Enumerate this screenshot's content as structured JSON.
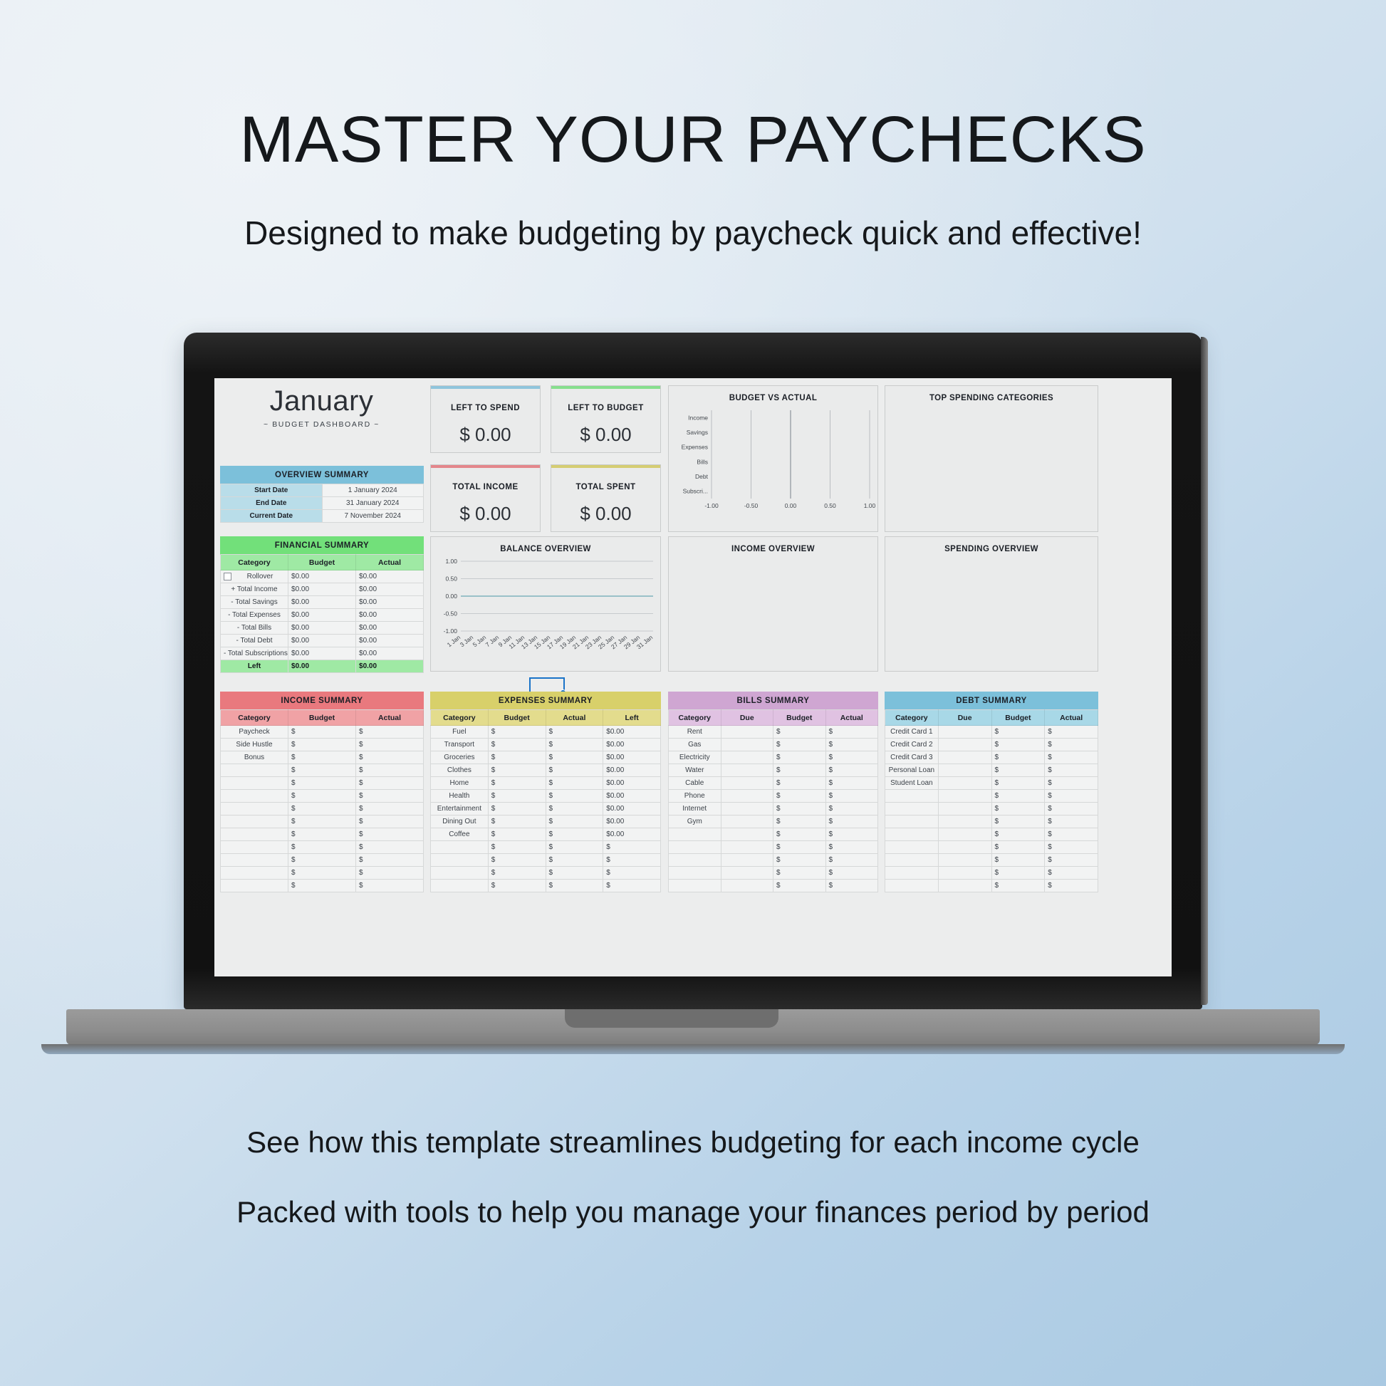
{
  "promo": {
    "title": "MASTER YOUR PAYCHECKS",
    "subtitle": "Designed to make budgeting by paycheck quick and effective!",
    "footer_line1": "See how this template streamlines budgeting for each income cycle",
    "footer_line2": "Packed with tools to help you manage your finances period by period"
  },
  "sheet": {
    "month": "January",
    "month_subtitle": "~ BUDGET DASHBOARD ~"
  },
  "kpis": [
    {
      "label": "LEFT TO SPEND",
      "value": "$ 0.00",
      "accent": "#8fc5dc"
    },
    {
      "label": "LEFT TO BUDGET",
      "value": "$ 0.00",
      "accent": "#86df8d"
    },
    {
      "label": "TOTAL INCOME",
      "value": "$ 0.00",
      "accent": "#e4868b"
    },
    {
      "label": "TOTAL SPENT",
      "value": "$ 0.00",
      "accent": "#d5cd72"
    }
  ],
  "overview_summary": {
    "title": "OVERVIEW SUMMARY",
    "rows": [
      {
        "key": "Start Date",
        "value": "1 January 2024"
      },
      {
        "key": "End Date",
        "value": "31 January 2024"
      },
      {
        "key": "Current Date",
        "value": "7 November 2024"
      }
    ]
  },
  "financial_summary": {
    "title": "FINANCIAL SUMMARY",
    "columns": [
      "Category",
      "Budget",
      "Actual"
    ],
    "rows": [
      {
        "category": "Rollover",
        "checkbox": true,
        "budget": "0.00",
        "actual": "0.00"
      },
      {
        "category": "+ Total Income",
        "checkbox": false,
        "budget": "0.00",
        "actual": "0.00"
      },
      {
        "category": "- Total Savings",
        "checkbox": false,
        "budget": "0.00",
        "actual": "0.00"
      },
      {
        "category": "- Total Expenses",
        "checkbox": false,
        "budget": "0.00",
        "actual": "0.00"
      },
      {
        "category": "- Total Bills",
        "checkbox": false,
        "budget": "0.00",
        "actual": "0.00"
      },
      {
        "category": "- Total Debt",
        "checkbox": false,
        "budget": "0.00",
        "actual": "0.00"
      },
      {
        "category": "- Total Subscriptions",
        "checkbox": false,
        "budget": "0.00",
        "actual": "0.00"
      }
    ],
    "total_row": {
      "label": "Left",
      "budget": "0.00",
      "actual": "0.00"
    }
  },
  "income_summary": {
    "title": "INCOME SUMMARY",
    "columns": [
      "Category",
      "Budget",
      "Actual"
    ],
    "categories": [
      "Paycheck",
      "Side Hustle",
      "Bonus",
      "",
      "",
      "",
      "",
      "",
      "",
      "",
      "",
      "",
      ""
    ],
    "currency": "$"
  },
  "expenses_summary": {
    "title": "EXPENSES SUMMARY",
    "columns": [
      "Category",
      "Budget",
      "Actual",
      "Left"
    ],
    "rows": [
      {
        "category": "Fuel",
        "left": "0.00"
      },
      {
        "category": "Transport",
        "left": "0.00"
      },
      {
        "category": "Groceries",
        "left": "0.00"
      },
      {
        "category": "Clothes",
        "left": "0.00"
      },
      {
        "category": "Home",
        "left": "0.00"
      },
      {
        "category": "Health",
        "left": "0.00"
      },
      {
        "category": "Entertainment",
        "left": "0.00"
      },
      {
        "category": "Dining Out",
        "left": "0.00"
      },
      {
        "category": "Coffee",
        "left": "0.00"
      },
      {
        "category": "",
        "left": ""
      },
      {
        "category": "",
        "left": ""
      },
      {
        "category": "",
        "left": ""
      },
      {
        "category": "",
        "left": ""
      }
    ],
    "currency": "$"
  },
  "bills_summary": {
    "title": "BILLS SUMMARY",
    "columns": [
      "Category",
      "Due",
      "Budget",
      "Actual"
    ],
    "categories": [
      "Rent",
      "Gas",
      "Electricity",
      "Water",
      "Cable",
      "Phone",
      "Internet",
      "Gym",
      "",
      "",
      "",
      "",
      ""
    ],
    "currency": "$"
  },
  "debt_summary": {
    "title": "DEBT SUMMARY",
    "columns": [
      "Category",
      "Due",
      "Budget",
      "Actual"
    ],
    "categories": [
      "Credit Card 1",
      "Credit Card 2",
      "Credit Card 3",
      "Personal Loan",
      "Student Loan",
      "",
      "",
      "",
      "",
      "",
      "",
      "",
      ""
    ],
    "currency": "$"
  },
  "panels": {
    "top_spending": "TOP SPENDING CATEGORIES",
    "income_overview": "INCOME OVERVIEW",
    "spending_overview": "SPENDING OVERVIEW"
  },
  "chart_data": [
    {
      "type": "bar",
      "title": "BUDGET VS ACTUAL",
      "orientation": "horizontal",
      "categories": [
        "Income",
        "Savings",
        "Expenses",
        "Bills",
        "Debt",
        "Subscri..."
      ],
      "series": [
        {
          "name": "Budget",
          "values": [
            0,
            0,
            0,
            0,
            0,
            0
          ]
        },
        {
          "name": "Actual",
          "values": [
            0,
            0,
            0,
            0,
            0,
            0
          ]
        }
      ],
      "xticks": [
        "-1.00",
        "-0.50",
        "0.00",
        "0.50",
        "1.00"
      ],
      "xlim": [
        -1,
        1
      ],
      "grid": true,
      "legend": "none",
      "xlabel": "",
      "ylabel": ""
    },
    {
      "type": "line",
      "title": "BALANCE OVERVIEW",
      "x": [
        "1 Jan",
        "3 Jan",
        "5 Jan",
        "7 Jan",
        "9 Jan",
        "11 Jan",
        "13 Jan",
        "15 Jan",
        "17 Jan",
        "19 Jan",
        "21 Jan",
        "23 Jan",
        "25 Jan",
        "27 Jan",
        "29 Jan",
        "31 Jan"
      ],
      "series": [
        {
          "name": "Balance",
          "color": "#7fb3bd",
          "values": [
            0,
            0,
            0,
            0,
            0,
            0,
            0,
            0,
            0,
            0,
            0,
            0,
            0,
            0,
            0,
            0
          ]
        }
      ],
      "yticks": [
        "1.00",
        "0.50",
        "0.00",
        "-0.50",
        "-1.00"
      ],
      "ylim": [
        -1,
        1
      ],
      "grid": true,
      "legend": "none",
      "xlabel": "",
      "ylabel": ""
    },
    {
      "type": "pie",
      "title": "TOP SPENDING CATEGORIES",
      "categories": [],
      "values": [],
      "note": "empty"
    },
    {
      "type": "pie",
      "title": "INCOME OVERVIEW",
      "categories": [],
      "values": [],
      "note": "empty"
    },
    {
      "type": "pie",
      "title": "SPENDING OVERVIEW",
      "categories": [],
      "values": [],
      "note": "empty"
    }
  ]
}
